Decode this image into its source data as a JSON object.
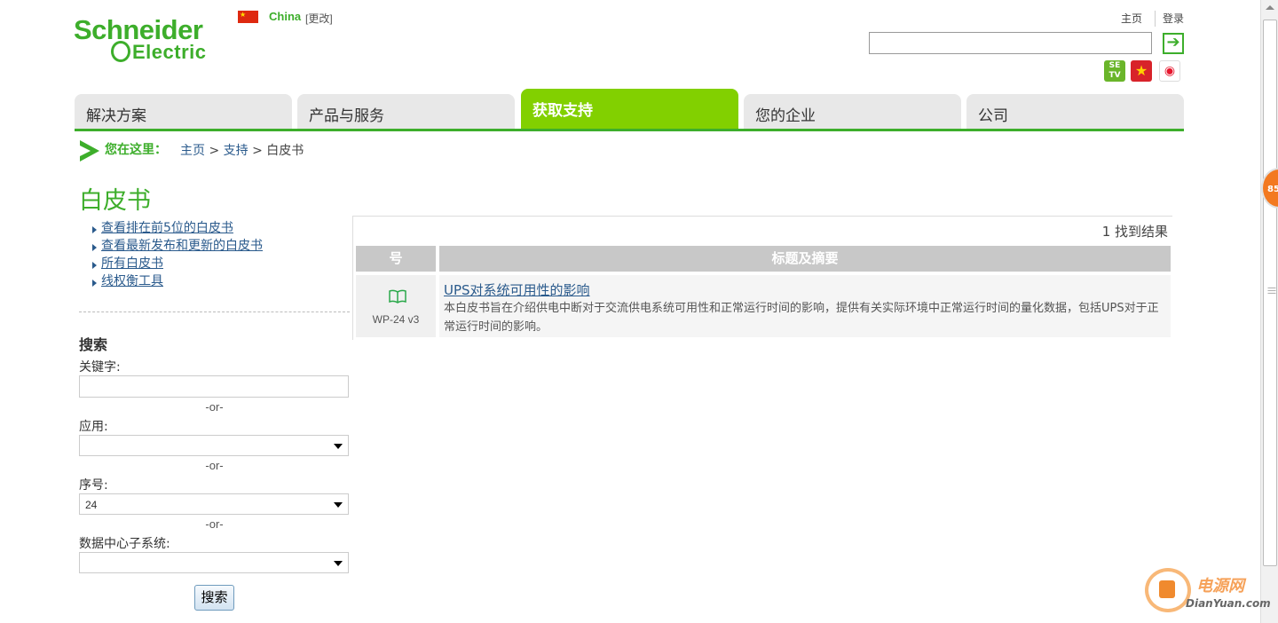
{
  "header": {
    "logo_line1": "Schneider",
    "logo_line2": "Electric",
    "country": "China",
    "change_label": "[更改]",
    "home_link": "主页",
    "login_link": "登录",
    "search_value": "",
    "go_icon": "login-arrow-icon",
    "social": [
      {
        "name": "setv-icon",
        "label": "SE TV"
      },
      {
        "name": "star-icon",
        "label": "★"
      },
      {
        "name": "weibo-icon",
        "label": "◉"
      }
    ]
  },
  "nav": {
    "tabs": [
      {
        "label": "解决方案",
        "active": false
      },
      {
        "label": "产品与服务",
        "active": false
      },
      {
        "label": "获取支持",
        "active": true
      },
      {
        "label": "您的企业",
        "active": false
      },
      {
        "label": "公司",
        "active": false
      }
    ],
    "accent": "#3dae2b",
    "active_color": "#82d000"
  },
  "breadcrumb": {
    "label": "您在这里：",
    "items": [
      "主页",
      "支持",
      "白皮书"
    ],
    "separator": ">"
  },
  "page": {
    "title": "白皮书"
  },
  "sidebar": {
    "links": [
      "查看排在前5位的白皮书",
      "查看最新发布和更新的白皮书",
      "所有白皮书",
      "线权衡工具"
    ],
    "search_heading": "搜索",
    "keyword_label": "关键字:",
    "keyword_value": "",
    "or_text": "-or-",
    "application_label": "应用:",
    "application_value": "",
    "serial_label": "序号:",
    "serial_value": "24",
    "subsystem_label": "数据中心子系统:",
    "subsystem_value": "",
    "submit_label": "搜索"
  },
  "results": {
    "count_text": "1 找到结果",
    "columns": [
      "号",
      "标题及摘要"
    ],
    "rows": [
      {
        "icon": "open-book-icon",
        "id": "WP-24 v3",
        "title": "UPS对系统可用性的影响",
        "desc": "本白皮书旨在介绍供电中断对于交流供电系统可用性和正常运行时间的影响，提供有关实际环境中正常运行时间的量化数据，包括UPS对于正常运行时间的影响。"
      }
    ]
  },
  "widgets": {
    "badge_text": "85",
    "watermark_cn": "电源网",
    "watermark_en": "DianYuan.com"
  }
}
